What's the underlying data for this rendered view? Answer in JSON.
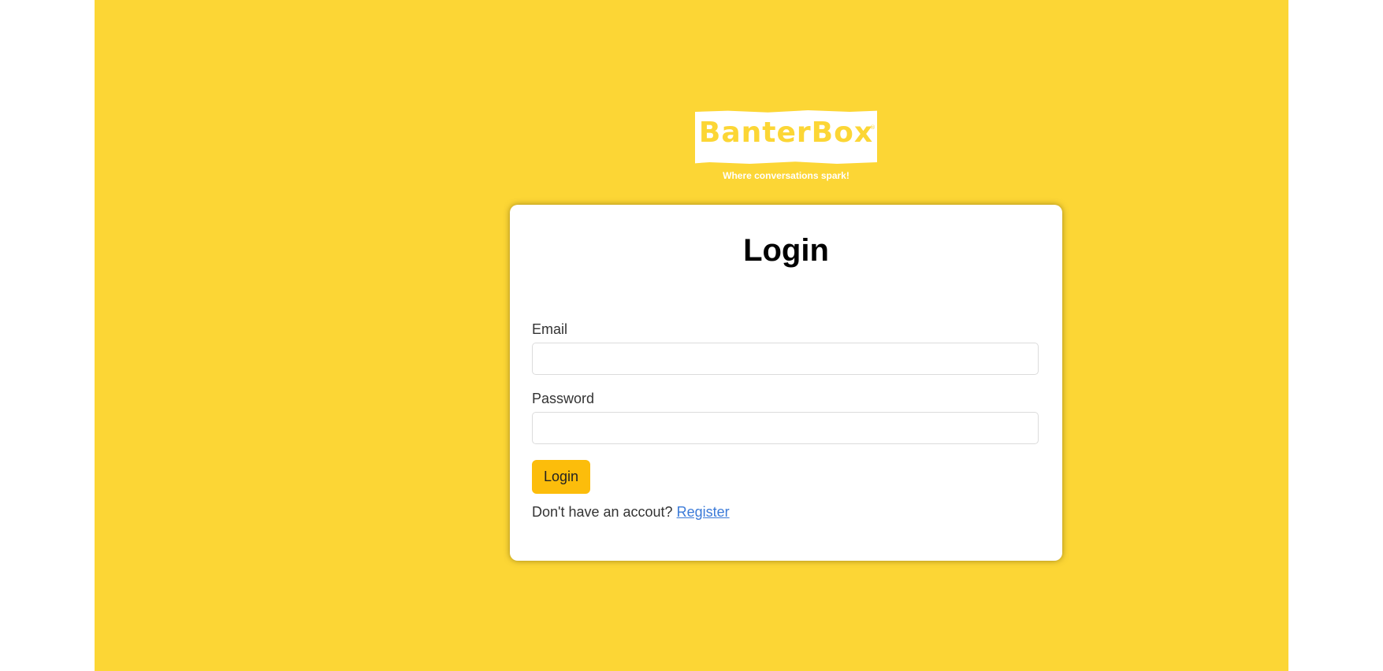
{
  "logo": {
    "name": "BanterBox",
    "reg_mark": "®",
    "tagline": "Where conversations spark!"
  },
  "login_form": {
    "title": "Login",
    "email_label": "Email",
    "email_value": "",
    "password_label": "Password",
    "password_value": "",
    "submit_label": "Login",
    "register_prompt": "Don't have an accout?",
    "register_link": "Register"
  },
  "colors": {
    "background": "#fcd635",
    "button": "#fcbd0b",
    "link": "#3a7ad8",
    "card": "#ffffff"
  }
}
